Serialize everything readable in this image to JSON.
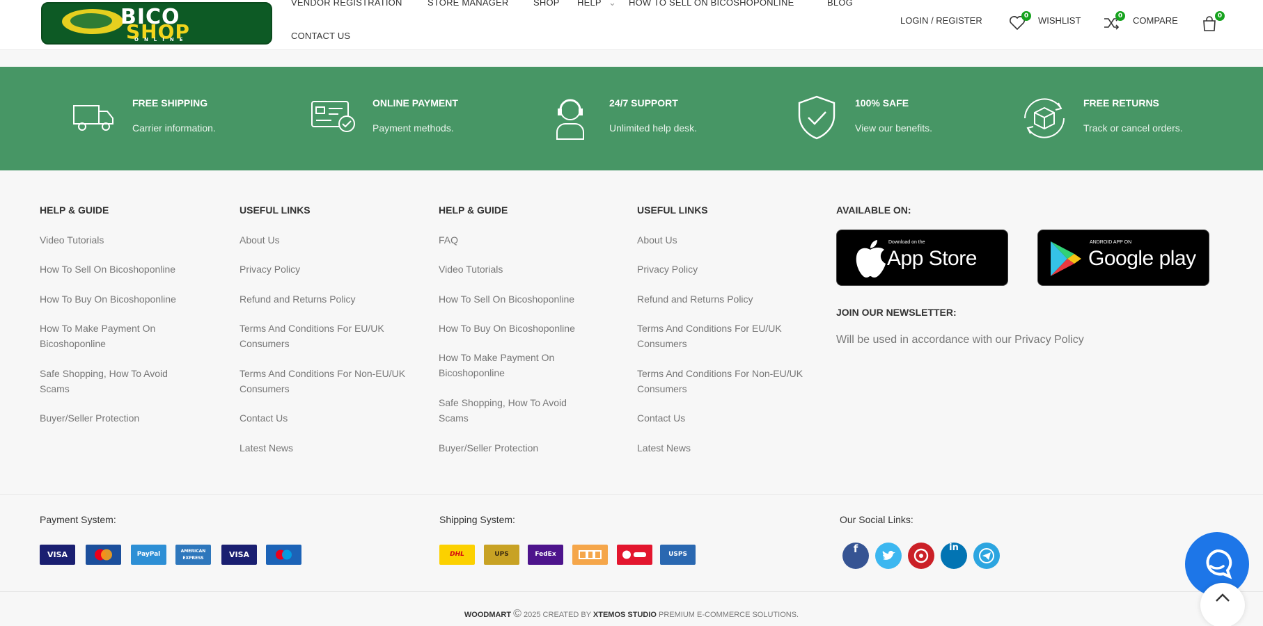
{
  "header": {
    "logo": {
      "line1": "BICO",
      "line2": "SHOP",
      "line3": "ONLINE"
    },
    "nav": [
      "VENDOR REGISTRATION",
      "STORE MANAGER",
      "SHOP",
      "HELP",
      "HOW TO SELL ON BICOSHOPONLINE",
      "BLOG",
      "CONTACT US"
    ],
    "login": "LOGIN / REGISTER",
    "wishlist": {
      "label": "WISHLIST",
      "count": "0"
    },
    "compare": {
      "label": "COMPARE",
      "count": "0"
    },
    "cart": {
      "count": "0"
    }
  },
  "features": [
    {
      "title": "FREE SHIPPING",
      "subtitle": "Carrier information.",
      "icon": "truck-icon"
    },
    {
      "title": "ONLINE PAYMENT",
      "subtitle": "Payment methods.",
      "icon": "card-check-icon"
    },
    {
      "title": "24/7 SUPPORT",
      "subtitle": "Unlimited help desk.",
      "icon": "support-agent-icon"
    },
    {
      "title": "100% SAFE",
      "subtitle": "View our benefits.",
      "icon": "shield-check-icon"
    },
    {
      "title": "FREE RETURNS",
      "subtitle": "Track or cancel orders.",
      "icon": "box-return-icon"
    }
  ],
  "columns": [
    {
      "title": "HELP & GUIDE",
      "links": [
        "Video Tutorials",
        "How To Sell On Bicoshoponline",
        "How To Buy On Bicoshoponline",
        "How To Make Payment On Bicoshoponline",
        "Safe Shopping, How To Avoid Scams",
        "Buyer/Seller Protection"
      ]
    },
    {
      "title": "USEFUL LINKS",
      "links": [
        "About Us",
        "Privacy Policy",
        "Refund and Returns Policy",
        "Terms And Conditions For EU/UK Consumers",
        "Terms And Conditions For Non-EU/UK Consumers",
        "Contact Us",
        "Latest News"
      ]
    },
    {
      "title": "HELP & GUIDE",
      "links": [
        "FAQ",
        "Video Tutorials",
        "How To Sell On Bicoshoponline",
        "How To Buy On Bicoshoponline",
        "How To Make Payment On Bicoshoponline",
        "Safe Shopping, How To Avoid Scams",
        "Buyer/Seller Protection"
      ]
    },
    {
      "title": "USEFUL LINKS",
      "links": [
        "About Us",
        "Privacy Policy",
        "Refund and Returns Policy",
        "Terms And Conditions For EU/UK Consumers",
        "Terms And Conditions For Non-EU/UK Consumers",
        "Contact Us",
        "Latest News"
      ]
    }
  ],
  "apps": {
    "title": "AVAILABLE ON:",
    "appstore": {
      "small": "Download on the",
      "big": "App Store"
    },
    "googleplay": {
      "small": "ANDROID APP ON",
      "big": "Google play"
    }
  },
  "newsletter": {
    "title": "JOIN OUR NEWSLETTER:",
    "text": "Will be used in accordance with our Privacy Policy"
  },
  "bottom": {
    "payment_label": "Payment System:",
    "shipping_label": "Shipping System:",
    "social_label": "Our Social Links:",
    "payments": [
      "VISA",
      "mastercard",
      "PayPal",
      "AMERICAN EXPRESS",
      "VISA",
      "maestro"
    ],
    "shipping": [
      "DHL",
      "UPS",
      "FedEx",
      "",
      "",
      "USPS"
    ],
    "social": [
      "facebook-icon",
      "twitter-icon",
      "pinterest-icon",
      "linkedin-icon",
      "telegram-icon"
    ]
  },
  "copyright": {
    "brand": "WOODMART",
    "symbol": "©",
    "year_text": "2025 CREATED BY",
    "studio": "XTEMOS STUDIO",
    "tail": "PREMIUM E-COMMERCE SOLUTIONS."
  },
  "colors": {
    "feature_band": "#479665",
    "badge": "#16a31e",
    "chat": "#1d76e8"
  }
}
